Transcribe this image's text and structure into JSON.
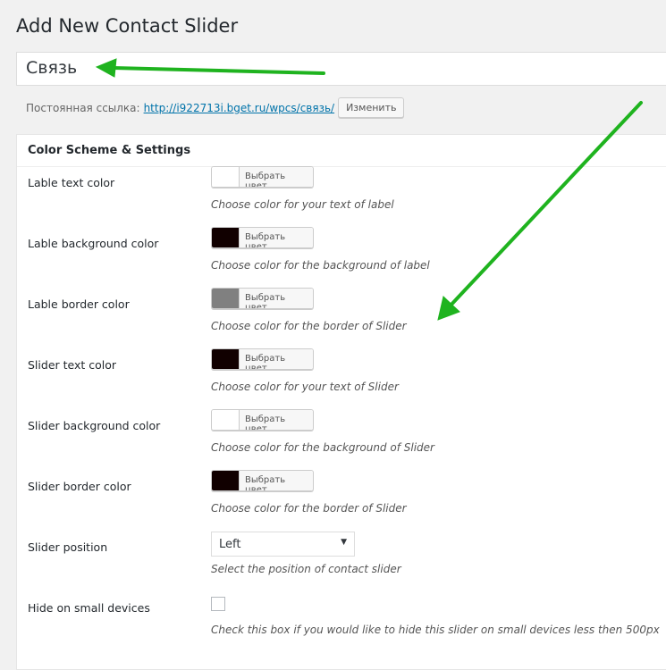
{
  "page_title": "Add New Contact Slider",
  "title_input_value": "Связь",
  "permalink": {
    "label": "Постоянная ссылка:",
    "url_prefix": "http://i922713i.bget.ru/wpcs/",
    "slug": "связь",
    "url_suffix": "/",
    "edit_button": "Изменить"
  },
  "panel": {
    "title": "Color Scheme & Settings"
  },
  "picker_button": "Выбрать цвет",
  "fields": [
    {
      "label": "Lable text color",
      "color": "#ffffff",
      "desc": "Choose color for your text of label"
    },
    {
      "label": "Lable background color",
      "color": "#110000",
      "desc": "Choose color for the background of label"
    },
    {
      "label": "Lable border color",
      "color": "#808080",
      "desc": "Choose color for the border of Slider"
    },
    {
      "label": "Slider text color",
      "color": "#110000",
      "desc": "Choose color for your text of Slider"
    },
    {
      "label": "Slider background color",
      "color": "#ffffff",
      "desc": "Choose color for the background of Slider"
    },
    {
      "label": "Slider border color",
      "color": "#110000",
      "desc": "Choose color for the border of Slider"
    }
  ],
  "position": {
    "label": "Slider position",
    "value": "Left",
    "desc": "Select the position of contact slider"
  },
  "hide_small": {
    "label": "Hide on small devices",
    "checked": false,
    "desc": "Check this box if you would like to hide this slider on small devices less then 500px"
  },
  "annotation_color": "#1fb31f"
}
